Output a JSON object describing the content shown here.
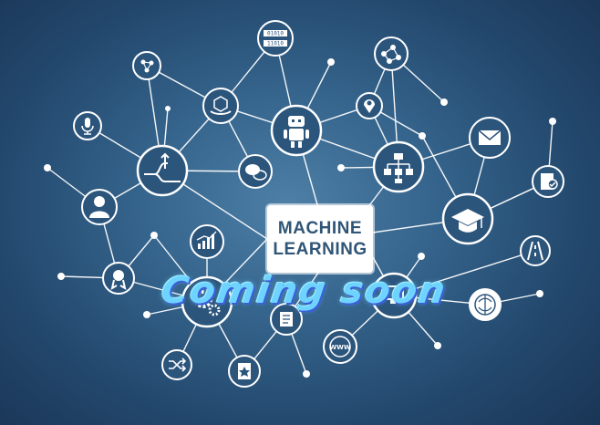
{
  "center_box": {
    "line1": "MACHINE",
    "line2": "LEARNING"
  },
  "overlay_text": "Coming soon",
  "icon_labels": {
    "binary_top": "01010",
    "binary_bottom": "11010",
    "www": "WWW"
  },
  "colors": {
    "background": "#2b5379",
    "node_outline": "#ffffff",
    "overlay_text": "#6fd3ff",
    "box_text": "#2f5577"
  },
  "icons": [
    "robot-icon",
    "gear-box-icon",
    "chat-icon",
    "flowchart-icon",
    "graduation-cap-icon",
    "envelope-icon",
    "location-pin-icon",
    "network-icon",
    "binary-icon",
    "hand-box-icon",
    "arrows-split-icon",
    "person-icon",
    "microphone-icon",
    "chart-icon",
    "award-icon",
    "gears-icon",
    "shuffle-icon",
    "document-star-icon",
    "www-icon",
    "clipboard-check-icon",
    "road-icon",
    "brain-icon",
    "monitor-icon"
  ]
}
